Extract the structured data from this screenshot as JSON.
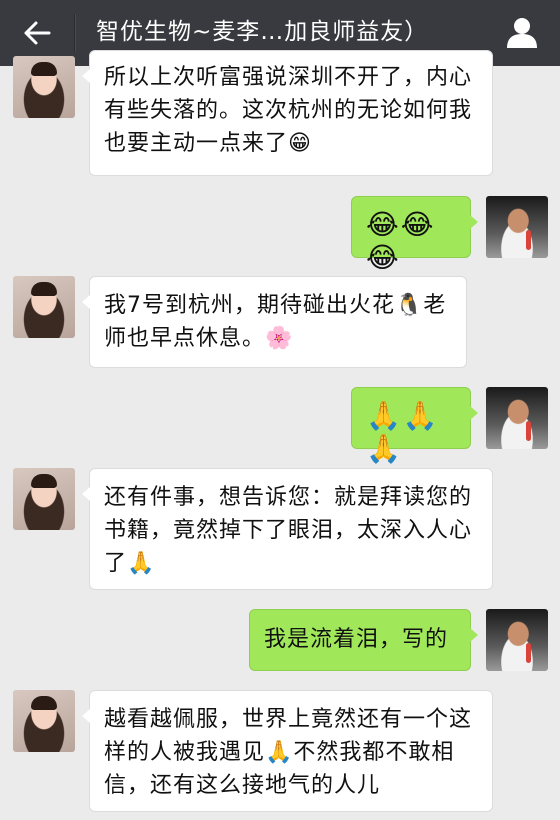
{
  "header": {
    "title": "智优生物~麦李…加良师益友）",
    "back_icon": "arrow-left-icon",
    "profile_icon": "person-icon"
  },
  "messages": [
    {
      "sender": "her",
      "text": "所以上次听富强说深圳不开了，内心有些失落的。这次杭州的无论如何我也要主动一点来了😁"
    },
    {
      "sender": "me",
      "text": "😂😂😂"
    },
    {
      "sender": "her",
      "text": "我7号到杭州，期待碰出火花🐧老师也早点休息。🌸"
    },
    {
      "sender": "me",
      "text": "🙏🙏🙏"
    },
    {
      "sender": "her",
      "text": "还有件事，想告诉您：就是拜读您的书籍，竟然掉下了眼泪，太深入人心了🙏"
    },
    {
      "sender": "me",
      "text": "我是流着泪，写的"
    },
    {
      "sender": "her",
      "text": "越看越佩服，世界上竟然还有一个这样的人被我遇见🙏不然我都不敢相信，还有这么接地气的人儿"
    }
  ],
  "colors": {
    "topbar": "#393a3f",
    "background": "#ebebeb",
    "bubble_in": "#ffffff",
    "bubble_out": "#a0e75a"
  }
}
